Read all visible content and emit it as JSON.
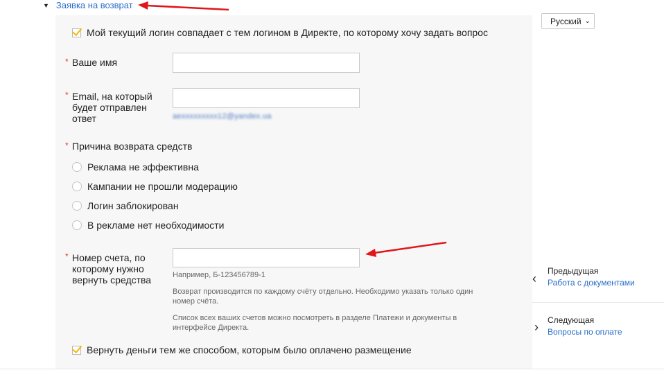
{
  "header": {
    "link_label": "Заявка на возврат"
  },
  "language": {
    "selected": "Русский"
  },
  "form": {
    "login_match_label": "Мой текущий логин совпадает с тем логином в Директе, по которому хочу задать вопрос",
    "name_label": "Ваше имя",
    "name_value": "",
    "email_label_1": "Email, на который",
    "email_label_2": "будет отправлен",
    "email_label_3": "ответ",
    "email_value": "",
    "email_blurred_text": "aexxxxxxxxx12@yandex.ua",
    "reason_label": "Причина возврата средств",
    "reasons": [
      "Реклама не эффективна",
      "Кампании не прошли модерацию",
      "Логин заблокирован",
      "В рекламе нет необходимости"
    ],
    "account_label_1": "Номер счета, по",
    "account_label_2": "которому нужно",
    "account_label_3": "вернуть средства",
    "account_value": "",
    "account_example": "Например, Б-123456789-1",
    "account_note_1": "Возврат производится по каждому счёту отдельно. Необходимо указать только один",
    "account_note_2": "номер счёта.",
    "account_note_3": "Список всех ваших счетов можно посмотреть в разделе Платежи и документы в",
    "account_note_4": "интерфейсе Директа.",
    "refund_same_method_label": "Вернуть деньги тем же способом, которым было оплачено размещение",
    "required_mark": "*"
  },
  "nav": {
    "prev_title": "Предыдущая",
    "prev_link": "Работа с документами",
    "next_title": "Следующая",
    "next_link": "Вопросы по оплате"
  },
  "colors": {
    "accent": "#f2b90a",
    "link": "#2a6fc9",
    "annotation_arrow": "#e0161b",
    "required": "#e03b2c"
  }
}
